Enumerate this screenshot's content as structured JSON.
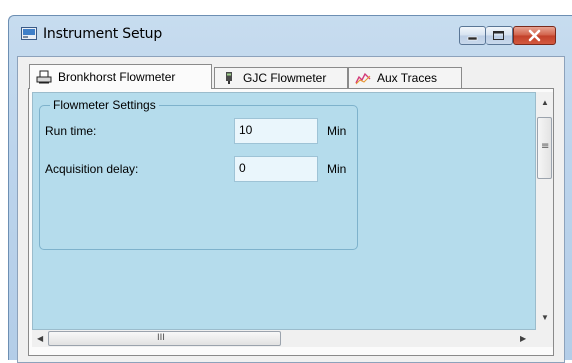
{
  "window": {
    "title": "Instrument Setup",
    "controls": {
      "minimize_icon": "minimize-icon",
      "maximize_icon": "maximize-icon",
      "close_icon": "close-icon"
    }
  },
  "tabs": [
    {
      "label": "Bronkhorst Flowmeter",
      "icon": "printer-icon",
      "active": true
    },
    {
      "label": "GJC Flowmeter",
      "icon": "device-icon",
      "active": false
    },
    {
      "label": "Aux Traces",
      "icon": "chart-trace-icon",
      "active": false
    }
  ],
  "flowmeter_settings": {
    "title": "Flowmeter Settings",
    "run_time": {
      "label": "Run time:",
      "value": "10",
      "unit": "Min"
    },
    "acquisition_delay": {
      "label": "Acquisition delay:",
      "value": "0",
      "unit": "Min"
    }
  },
  "scrollbars": {
    "vertical_grip": "≡",
    "horizontal_grip": "III"
  },
  "colors": {
    "content_background": "#b5dcec",
    "window_frame": "#bcd4ec",
    "close_button": "#c2412a"
  }
}
